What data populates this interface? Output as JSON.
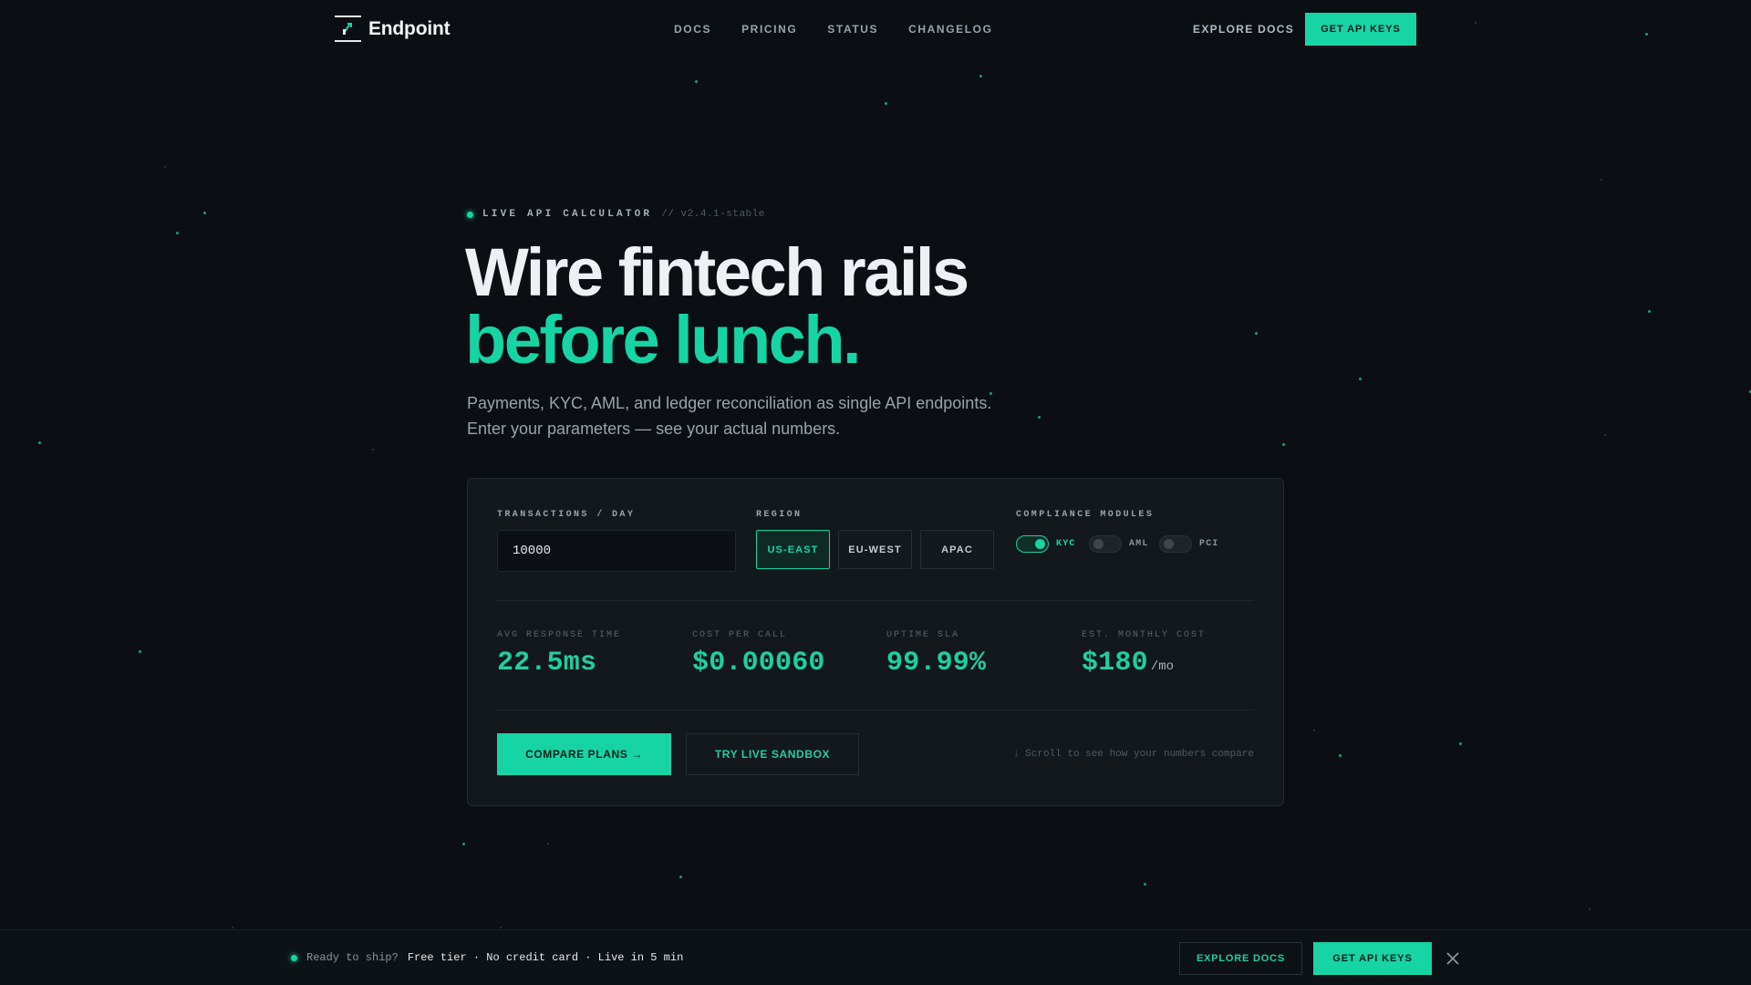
{
  "brand": {
    "name": "Endpoint"
  },
  "nav": {
    "links": [
      "DOCS",
      "PRICING",
      "STATUS",
      "CHANGELOG"
    ],
    "explore": "EXPLORE DOCS",
    "cta": "GET API KEYS"
  },
  "hero": {
    "eyebrow": "LIVE API CALCULATOR",
    "version": "// v2.4.1-stable",
    "title_line1": "Wire fintech rails",
    "title_line2": "before lunch.",
    "subtitle_line1": "Payments, KYC, AML, and ledger reconciliation as single API endpoints.",
    "subtitle_line2": "Enter your parameters — see your actual numbers."
  },
  "calculator": {
    "transactions_label": "TRANSACTIONS / DAY",
    "transactions_value": "10000",
    "region_label": "REGION",
    "regions": [
      "US-EAST",
      "EU-WEST",
      "APAC"
    ],
    "region_selected": "US-EAST",
    "compliance_label": "COMPLIANCE MODULES",
    "modules": [
      {
        "label": "KYC",
        "on": true
      },
      {
        "label": "AML",
        "on": false
      },
      {
        "label": "PCI",
        "on": false
      }
    ],
    "metrics": [
      {
        "label": "AVG RESPONSE TIME",
        "value": "22.5ms",
        "unit": ""
      },
      {
        "label": "COST PER CALL",
        "value": "$0.00060",
        "unit": ""
      },
      {
        "label": "UPTIME SLA",
        "value": "99.99%",
        "unit": ""
      },
      {
        "label": "EST. MONTHLY COST",
        "value": "$180",
        "unit": "/mo"
      }
    ],
    "compare_button": "COMPARE PLANS →",
    "sandbox_button": "TRY LIVE SANDBOX",
    "scroll_hint": "↓ Scroll to see how your numbers compare"
  },
  "bottom_bar": {
    "prefix": "Ready to ship?",
    "highlight": "Free tier · No credit card · Live in 5 min",
    "explore": "EXPLORE DOCS",
    "cta": "GET API KEYS"
  },
  "colors": {
    "accent": "#17d4a4",
    "background": "#0b0f13",
    "card": "#13181d"
  }
}
